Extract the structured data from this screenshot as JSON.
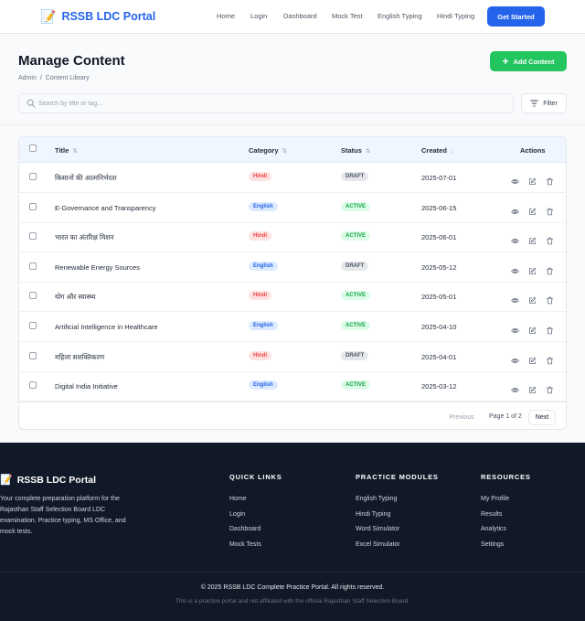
{
  "nav": {
    "brand_icon": "📝",
    "brand": "RSSB LDC Portal",
    "links": [
      "Home",
      "Login",
      "Dashboard",
      "Mock Test",
      "English Typing",
      "Hindi Typing"
    ],
    "cta": "Get Started"
  },
  "header": {
    "title": "Manage Content",
    "breadcrumb": [
      "Admin",
      "/",
      "Content Library"
    ],
    "add_button": "Add Content",
    "add_icon": "+",
    "search_placeholder": "Search by title or tag...",
    "filter_label": "Filter"
  },
  "table": {
    "columns": {
      "title": "Title",
      "category": "Category",
      "status": "Status",
      "created": "Created",
      "actions": "Actions"
    },
    "sort_icons": {
      "title": "⇅",
      "category": "⇅",
      "status": "⇅",
      "created": "↓"
    },
    "rows": [
      {
        "title": "किसानों की आत्मनिर्भरता",
        "category": "Hindi",
        "status": "DRAFT",
        "created": "2025-07-01"
      },
      {
        "title": "E-Governance and Transparency",
        "category": "English",
        "status": "ACTIVE",
        "created": "2025-06-15"
      },
      {
        "title": "भारत का अंतरिक्ष मिशन",
        "category": "Hindi",
        "status": "ACTIVE",
        "created": "2025-06-01"
      },
      {
        "title": "Renewable Energy Sources",
        "category": "English",
        "status": "DRAFT",
        "created": "2025-05-12"
      },
      {
        "title": "योग और स्वास्थ्य",
        "category": "Hindi",
        "status": "ACTIVE",
        "created": "2025-05-01"
      },
      {
        "title": "Artificial Intelligence in Healthcare",
        "category": "English",
        "status": "ACTIVE",
        "created": "2025-04-10"
      },
      {
        "title": "महिला सशक्तिकरण",
        "category": "Hindi",
        "status": "DRAFT",
        "created": "2025-04-01"
      },
      {
        "title": "Digital India Initiative",
        "category": "English",
        "status": "ACTIVE",
        "created": "2025-03-12"
      }
    ],
    "pagination": {
      "previous": "Previous",
      "info": "Page 1 of 2",
      "next": "Next"
    }
  },
  "footer": {
    "brand_icon": "📝",
    "brand": "RSSB LDC Portal",
    "description": "Your complete preparation platform for the Rajasthan Staff Selection Board LDC examination. Practice typing, MS Office, and mock tests.",
    "columns": [
      {
        "heading": "QUICK LINKS",
        "links": [
          "Home",
          "Login",
          "Dashboard",
          "Mock Tests"
        ]
      },
      {
        "heading": "PRACTICE MODULES",
        "links": [
          "English Typing",
          "Hindi Typing",
          "Word Simulator",
          "Excel Simulator"
        ]
      },
      {
        "heading": "RESOURCES",
        "links": [
          "My Profile",
          "Results",
          "Analytics",
          "Settings"
        ]
      }
    ],
    "copyright": "© 2025 RSSB LDC Complete Practice Portal. All rights reserved.",
    "disclaimer": "This is a practice portal and not affiliated with the official Rajasthan Staff Selection Board."
  },
  "colors": {
    "primary": "#2563eb",
    "success": "#22c55e",
    "hindi_badge_bg": "#fee2e2",
    "hindi_badge_fg": "#ef4444",
    "english_badge_bg": "#dbeafe",
    "english_badge_fg": "#2563eb",
    "active_bg": "#dcfce7",
    "active_fg": "#16a34a",
    "draft_bg": "#e5e7eb",
    "draft_fg": "#4b5563",
    "footer_bg": "#111827"
  }
}
